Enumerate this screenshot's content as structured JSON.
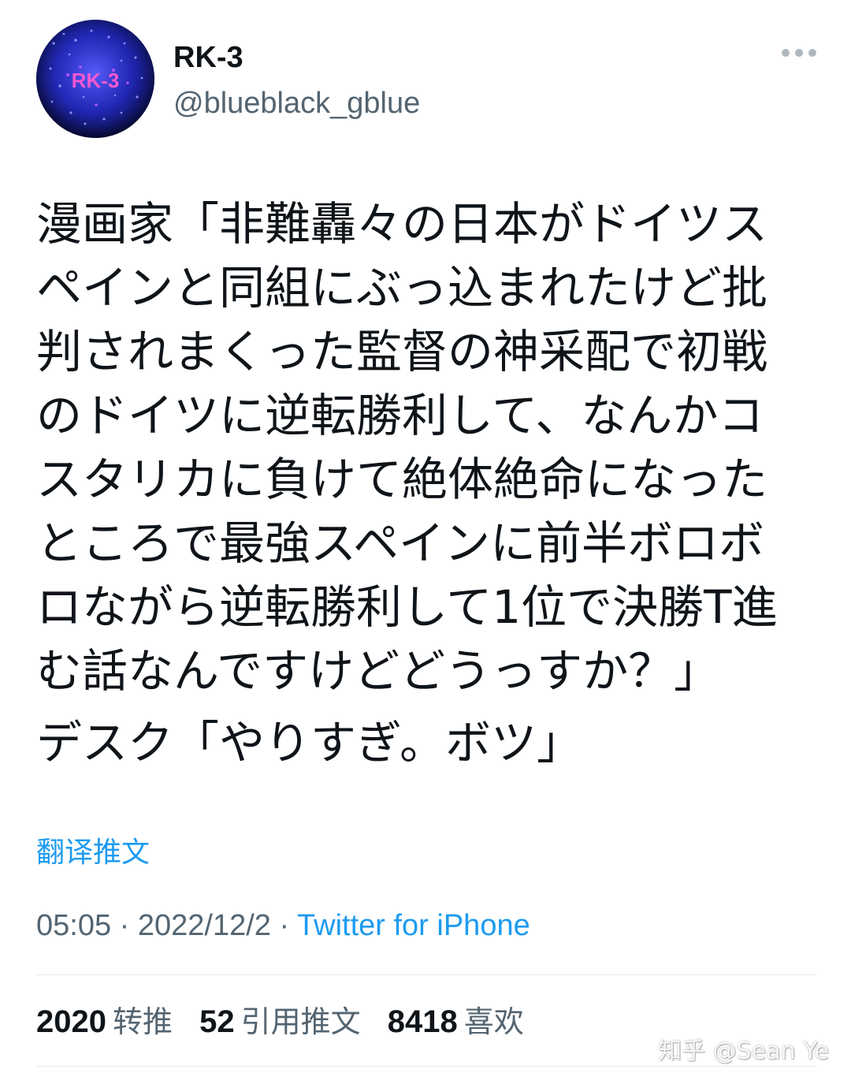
{
  "author": {
    "display_name": "RK-3",
    "handle": "@blueblack_gblue",
    "avatar_icon": "avatar-image",
    "avatar_text": "RK-3"
  },
  "more_icon": "more-horizontal-icon",
  "tweet": {
    "lines": [
      "漫画家「非難轟々の日本がドイツス",
      "ペインと同組にぶっ込まれたけど批",
      "判されまくった監督の神采配で初戦",
      "のドイツに逆転勝利して、なんかコ",
      "スタリカに負けて絶体絶命になった",
      "ところで最強スペインに前半ボロボ",
      "ロながら逆転勝利して1位で決勝T進",
      "む話なんですけどどうっすか？」"
    ],
    "second_paragraph": "デスク「やりすぎ。ボツ」"
  },
  "translate_label": "翻译推文",
  "meta": {
    "time": "05:05",
    "date": "2022/12/2",
    "separator": "·",
    "source": "Twitter for iPhone"
  },
  "stats": {
    "retweets_count": "2020",
    "retweets_label": "转推",
    "quotes_count": "52",
    "quotes_label": "引用推文",
    "likes_count": "8418",
    "likes_label": "喜欢"
  },
  "watermark": "知乎 @Sean Ye",
  "colors": {
    "text_primary": "#0f1419",
    "text_secondary": "#536471",
    "accent": "#1d9bf0",
    "divider": "#e6ecf0"
  }
}
